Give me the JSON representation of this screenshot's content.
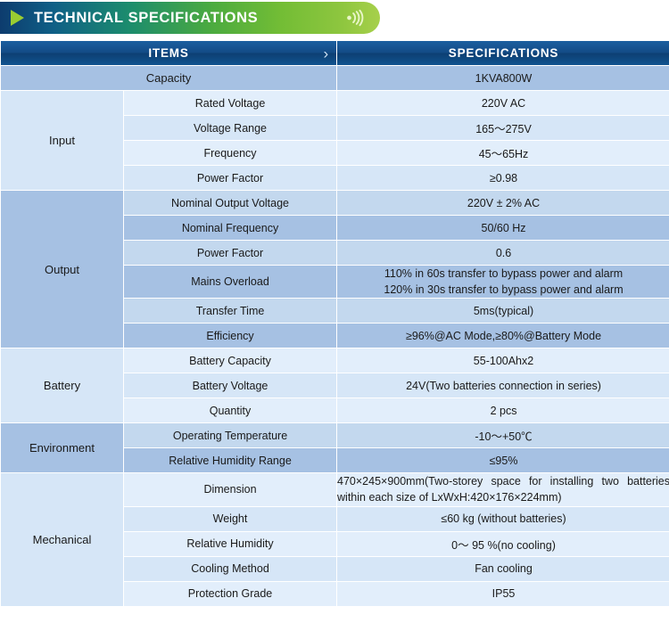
{
  "banner": {
    "title": "TECHNICAL SPECIFICATIONS",
    "play_icon": "play-triangle-icon",
    "wave_icon": "sound-wave-icon",
    "gradient_from": "#0d3c6e",
    "gradient_to": "#a7d04b"
  },
  "table": {
    "headers": {
      "items": "ITEMS",
      "specifications": "SPECIFICATIONS",
      "chevron": "›"
    },
    "capacity": {
      "label": "Capacity",
      "value": "1KVA800W"
    },
    "groups": [
      {
        "name": "Input",
        "rows": [
          {
            "item": "Rated Voltage",
            "spec": "220V AC"
          },
          {
            "item": "Voltage Range",
            "spec": "165～275V"
          },
          {
            "item": "Frequency",
            "spec": "45～65Hz"
          },
          {
            "item": "Power Factor",
            "spec": "≥0.98"
          }
        ]
      },
      {
        "name": "Output",
        "rows": [
          {
            "item": "Nominal Output Voltage",
            "spec": "220V ± 2% AC"
          },
          {
            "item": "Nominal Frequency",
            "spec": "50/60 Hz"
          },
          {
            "item": "Power Factor",
            "spec": "0.6"
          },
          {
            "item": "Mains Overload",
            "spec": "110% in 60s transfer to bypass power and alarm",
            "spec_line2": "120% in 30s transfer to bypass power and alarm"
          },
          {
            "item": "Transfer Time",
            "spec": "5ms(typical)"
          },
          {
            "item": "Efficiency",
            "spec": "≥96%@AC Mode,≥80%@Battery Mode"
          }
        ]
      },
      {
        "name": "Battery",
        "rows": [
          {
            "item": "Battery Capacity",
            "spec": "55-100Ahx2"
          },
          {
            "item": "Battery Voltage",
            "spec": "24V(Two batteries connection in series)"
          },
          {
            "item": "Quantity",
            "spec": "2 pcs"
          }
        ]
      },
      {
        "name": "Environment",
        "rows": [
          {
            "item": "Operating Temperature",
            "spec": "-10～+50℃"
          },
          {
            "item": "Relative Humidity Range",
            "spec": "≤95%"
          }
        ]
      },
      {
        "name": "Mechanical",
        "rows": [
          {
            "item": "Dimension",
            "spec": "470×245×900mm(Two-storey space for installing two batteries within each size of LxWxH:420×176×224mm)"
          },
          {
            "item": "Weight",
            "spec": "≤60 kg (without batteries)"
          },
          {
            "item": "Relative Humidity",
            "spec": "0～ 95 %(no cooling)"
          },
          {
            "item": "Cooling Method",
            "spec": "Fan cooling"
          },
          {
            "item": "Protection Grade",
            "spec": "IP55"
          }
        ]
      }
    ]
  }
}
